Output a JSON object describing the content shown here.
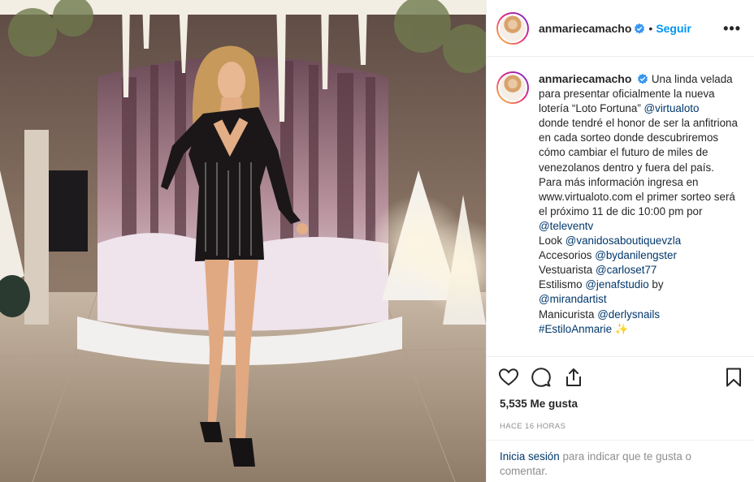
{
  "colors": {
    "accent": "#0095f6",
    "link": "#00376b",
    "muted": "#8e8e8e",
    "text": "#262626"
  },
  "icons": {
    "verified": "verified-badge-icon",
    "more": "more-options-icon",
    "like": "heart-icon",
    "comment": "comment-icon",
    "share": "share-icon",
    "save": "bookmark-icon"
  },
  "header": {
    "username": "anmariecamacho",
    "separator": "•",
    "follow_label": "Seguir",
    "more_glyph": "•••"
  },
  "caption": {
    "username": "anmariecamacho",
    "p1": "Una linda velada para presentar oficialmente la nueva lotería “Loto Fortuna”",
    "p1_mention": "@virtualoto",
    "p2": "donde tendré el honor de ser la anfitriona en cada sorteo donde descubriremos cómo cambiar el futuro de miles de venezolanos dentro y fuera del país.",
    "p3": "Para más información ingresa en www.virtualoto.com el primer sorteo será el próximo 11 de dic 10:00 pm por",
    "p3_mention": "@televentv",
    "credits": [
      {
        "label": "Look",
        "mention": "@vanidosaboutiquevzla"
      },
      {
        "label": "Accesorios",
        "mention": "@bydanilengster"
      },
      {
        "label": "Vestuarista",
        "mention": "@carloset77"
      },
      {
        "label": "Estilismo",
        "mention": "@jenafstudio",
        "suffix": "by"
      }
    ],
    "credit_by_mention": "@mirandartist",
    "manicure_label": "Manicurista",
    "manicure_mention": "@derlysnails",
    "hashtag": "#EstiloAnmarie",
    "hashtag_emoji": "✨"
  },
  "stats": {
    "likes": "5,535 Me gusta",
    "time": "HACE 16 HORAS"
  },
  "login": {
    "link": "Inicia sesión",
    "text": "para indicar que te gusta o comentar."
  }
}
